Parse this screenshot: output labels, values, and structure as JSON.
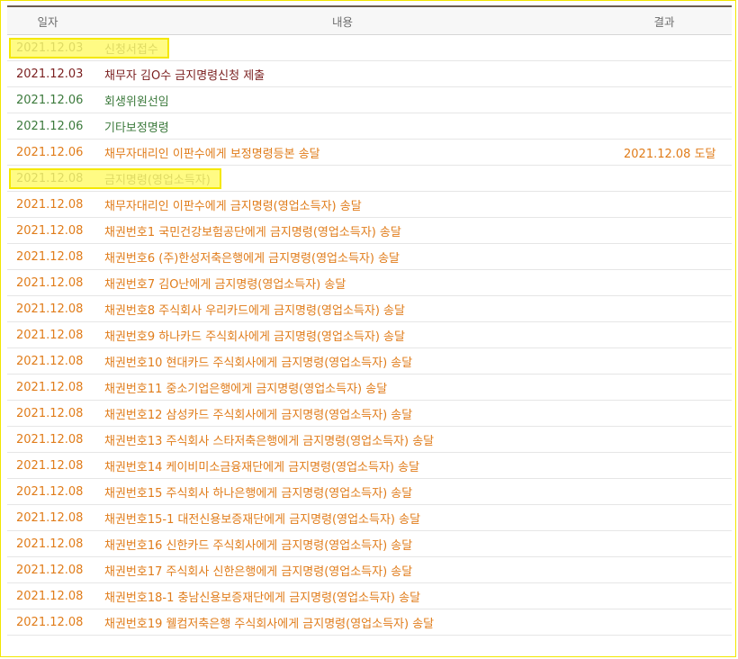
{
  "headers": {
    "date": "일자",
    "content": "내용",
    "result": "결과"
  },
  "rows": [
    {
      "date": "2021.12.03",
      "content": "신청서접수",
      "result": "",
      "color": "black",
      "highlight": true
    },
    {
      "date": "2021.12.03",
      "content": "채무자 김O수 금지명령신청 제출",
      "result": "",
      "color": "maroon",
      "highlight": false
    },
    {
      "date": "2021.12.06",
      "content": "회생위원선임",
      "result": "",
      "color": "green",
      "highlight": false
    },
    {
      "date": "2021.12.06",
      "content": "기타보정명령",
      "result": "",
      "color": "green",
      "highlight": false
    },
    {
      "date": "2021.12.06",
      "content": "채무자대리인 이판수에게 보정명령등본 송달",
      "result": "2021.12.08 도달",
      "color": "orange",
      "highlight": false
    },
    {
      "date": "2021.12.08",
      "content": "금지명령(영업소득자)",
      "result": "",
      "color": "black",
      "highlight": true
    },
    {
      "date": "2021.12.08",
      "content": "채무자대리인 이판수에게 금지명령(영업소득자) 송달",
      "result": "",
      "color": "orange",
      "highlight": false
    },
    {
      "date": "2021.12.08",
      "content": "채권번호1 국민건강보험공단에게 금지명령(영업소득자) 송달",
      "result": "",
      "color": "orange",
      "highlight": false
    },
    {
      "date": "2021.12.08",
      "content": "채권번호6 (주)한성저축은행에게 금지명령(영업소득자) 송달",
      "result": "",
      "color": "orange",
      "highlight": false
    },
    {
      "date": "2021.12.08",
      "content": "채권번호7 김O난에게 금지명령(영업소득자) 송달",
      "result": "",
      "color": "orange",
      "highlight": false
    },
    {
      "date": "2021.12.08",
      "content": "채권번호8 주식회사 우리카드에게 금지명령(영업소득자) 송달",
      "result": "",
      "color": "orange",
      "highlight": false
    },
    {
      "date": "2021.12.08",
      "content": "채권번호9 하나카드 주식회사에게 금지명령(영업소득자) 송달",
      "result": "",
      "color": "orange",
      "highlight": false
    },
    {
      "date": "2021.12.08",
      "content": "채권번호10 현대카드 주식회사에게 금지명령(영업소득자) 송달",
      "result": "",
      "color": "orange",
      "highlight": false
    },
    {
      "date": "2021.12.08",
      "content": "채권번호11 중소기업은행에게 금지명령(영업소득자) 송달",
      "result": "",
      "color": "orange",
      "highlight": false
    },
    {
      "date": "2021.12.08",
      "content": "채권번호12 삼성카드 주식회사에게 금지명령(영업소득자) 송달",
      "result": "",
      "color": "orange",
      "highlight": false
    },
    {
      "date": "2021.12.08",
      "content": "채권번호13 주식회사 스타저축은행에게 금지명령(영업소득자) 송달",
      "result": "",
      "color": "orange",
      "highlight": false
    },
    {
      "date": "2021.12.08",
      "content": "채권번호14 케이비미소금융재단에게 금지명령(영업소득자) 송달",
      "result": "",
      "color": "orange",
      "highlight": false
    },
    {
      "date": "2021.12.08",
      "content": "채권번호15 주식회사 하나은행에게 금지명령(영업소득자) 송달",
      "result": "",
      "color": "orange",
      "highlight": false
    },
    {
      "date": "2021.12.08",
      "content": "채권번호15-1 대전신용보증재단에게 금지명령(영업소득자) 송달",
      "result": "",
      "color": "orange",
      "highlight": false
    },
    {
      "date": "2021.12.08",
      "content": "채권번호16 신한카드 주식회사에게 금지명령(영업소득자) 송달",
      "result": "",
      "color": "orange",
      "highlight": false
    },
    {
      "date": "2021.12.08",
      "content": "채권번호17 주식회사 신한은행에게 금지명령(영업소득자) 송달",
      "result": "",
      "color": "orange",
      "highlight": false
    },
    {
      "date": "2021.12.08",
      "content": "채권번호18-1 충남신용보증재단에게 금지명령(영업소득자) 송달",
      "result": "",
      "color": "orange",
      "highlight": false
    },
    {
      "date": "2021.12.08",
      "content": "채권번호19 웰컴저축은행 주식회사에게 금지명령(영업소득자) 송달",
      "result": "",
      "color": "orange",
      "highlight": false
    }
  ]
}
